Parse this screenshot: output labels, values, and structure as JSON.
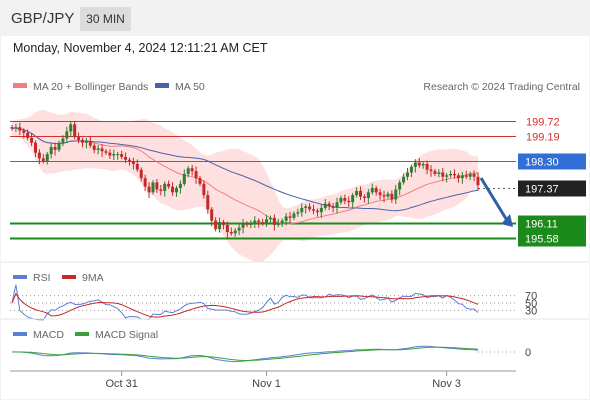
{
  "header": {
    "pair": "GBP/JPY",
    "timeframe": "30 MIN"
  },
  "timestamp": "Monday, November 4, 2024 12:11:21 AM CET",
  "legend": {
    "ma": "MA 20 + Bollinger Bands",
    "ma50": "MA 50",
    "credit": "Research © 2024 Trading Central"
  },
  "rsi_legend": {
    "rsi": "RSI",
    "ma": "9MA"
  },
  "macd_legend": {
    "macd": "MACD",
    "signal": "MACD Signal"
  },
  "colors": {
    "up": "#2e7d32",
    "down": "#c62828",
    "resistance": "#d32f2f",
    "pivot": "#2f6fd6",
    "support": "#1b8a1b",
    "last": "#222222",
    "ma20": "#f08080",
    "ma50": "#4a63a8",
    "band": "#ffd6d6",
    "rsi": "#5b7fd6",
    "rsi_ma": "#c62828",
    "macd": "#5b7fd6",
    "signal": "#3aa13a"
  },
  "chart_data": {
    "type": "candlestick",
    "instrument": "GBP/JPY",
    "ylim": [
      194.6,
      200.6
    ],
    "levels": [
      {
        "name": "resistance-2",
        "value": 199.72,
        "label": "199.72",
        "kind": "resistance"
      },
      {
        "name": "resistance-1",
        "value": 199.19,
        "label": "199.19",
        "kind": "resistance"
      },
      {
        "name": "pivot",
        "value": 198.3,
        "label": "198.30",
        "kind": "pivot"
      },
      {
        "name": "last-price",
        "value": 197.37,
        "label": "197.37",
        "kind": "last"
      },
      {
        "name": "support-1",
        "value": 196.11,
        "label": "196.11",
        "kind": "support"
      },
      {
        "name": "support-2",
        "value": 195.58,
        "label": "195.58",
        "kind": "support"
      }
    ],
    "closes": [
      199.45,
      199.5,
      199.38,
      199.3,
      199.12,
      198.95,
      198.6,
      198.4,
      198.3,
      198.55,
      198.8,
      198.7,
      198.95,
      199.1,
      199.35,
      199.6,
      199.15,
      199.05,
      198.95,
      199.0,
      198.85,
      198.7,
      198.75,
      198.65,
      198.6,
      198.5,
      198.55,
      198.55,
      198.45,
      198.35,
      198.3,
      198.2,
      198.0,
      197.7,
      197.4,
      197.2,
      197.55,
      197.3,
      197.25,
      197.5,
      197.4,
      197.2,
      197.35,
      197.5,
      197.85,
      198.05,
      197.95,
      197.7,
      197.5,
      197.1,
      196.6,
      196.2,
      195.9,
      196.15,
      196.05,
      195.8,
      195.75,
      195.85,
      195.95,
      196.1,
      196.05,
      196.1,
      196.2,
      196.15,
      196.1,
      196.25,
      196.3,
      196.05,
      196.1,
      196.2,
      196.35,
      196.3,
      196.45,
      196.5,
      196.65,
      196.7,
      196.6,
      196.55,
      196.5,
      196.65,
      196.8,
      196.7,
      196.65,
      196.85,
      197.0,
      196.9,
      196.85,
      197.1,
      197.25,
      197.05,
      197.0,
      197.2,
      197.35,
      197.2,
      197.1,
      197.05,
      197.15,
      196.95,
      197.3,
      197.55,
      197.75,
      197.9,
      198.1,
      198.25,
      198.15,
      198.2,
      198.0,
      197.95,
      197.85,
      197.9,
      197.75,
      197.8,
      197.85,
      197.8,
      197.7,
      197.8,
      197.75,
      197.85,
      197.75,
      197.45
    ],
    "rsi": {
      "levels": [
        70,
        50,
        30
      ],
      "level_labels": [
        "70",
        "50",
        "30"
      ],
      "ylim": [
        20,
        80
      ]
    },
    "macd": {
      "levels": [
        0
      ],
      "level_labels": [
        "0"
      ],
      "ylim": [
        -1.0,
        0.5
      ]
    },
    "x_ticks": [
      {
        "label": "Oct 31",
        "index": 28
      },
      {
        "label": "Nov 1",
        "index": 65
      },
      {
        "label": "Nov 3",
        "index": 111
      }
    ]
  }
}
